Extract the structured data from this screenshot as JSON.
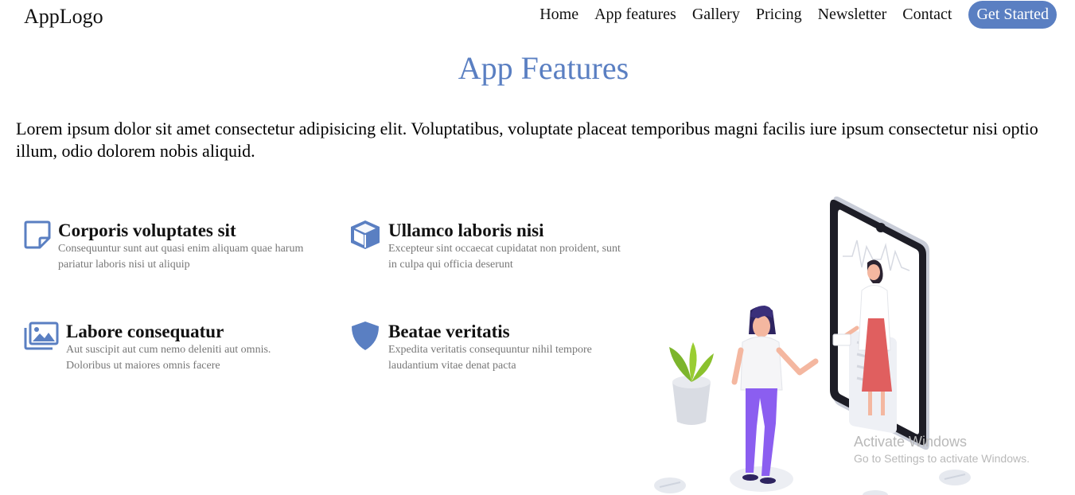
{
  "header": {
    "logo": "AppLogo",
    "nav": [
      "Home",
      "App features",
      "Gallery",
      "Pricing",
      "Newsletter",
      "Contact"
    ],
    "cta": "Get Started"
  },
  "section": {
    "title": "App Features",
    "intro": "Lorem ipsum dolor sit amet consectetur adipisicing elit. Voluptatibus, voluptate placeat temporibus magni facilis iure ipsum consectetur nisi optio illum, odio dolorem nobis aliquid."
  },
  "features": [
    {
      "title": "Corporis voluptates sit",
      "desc": "Consequuntur sunt aut quasi enim aliquam quae harum pariatur laboris nisi ut aliquip",
      "icon": "sticky-note-icon"
    },
    {
      "title": "Ullamco laboris nisi",
      "desc": "Excepteur sint occaecat cupidatat non proident, sunt in culpa qui officia deserunt",
      "icon": "cube-icon"
    },
    {
      "title": "Labore consequatur",
      "desc": "Aut suscipit aut cum nemo deleniti aut omnis. Doloribus ut maiores omnis facere",
      "icon": "images-icon"
    },
    {
      "title": "Beatae veritatis",
      "desc": "Expedita veritatis consequuntur nihil tempore laudantium vitae denat pacta",
      "icon": "shield-icon"
    }
  ],
  "watermark": {
    "line1": "Activate Windows",
    "line2": "Go to Settings to activate Windows."
  },
  "colors": {
    "accent": "#5a7fc2"
  }
}
